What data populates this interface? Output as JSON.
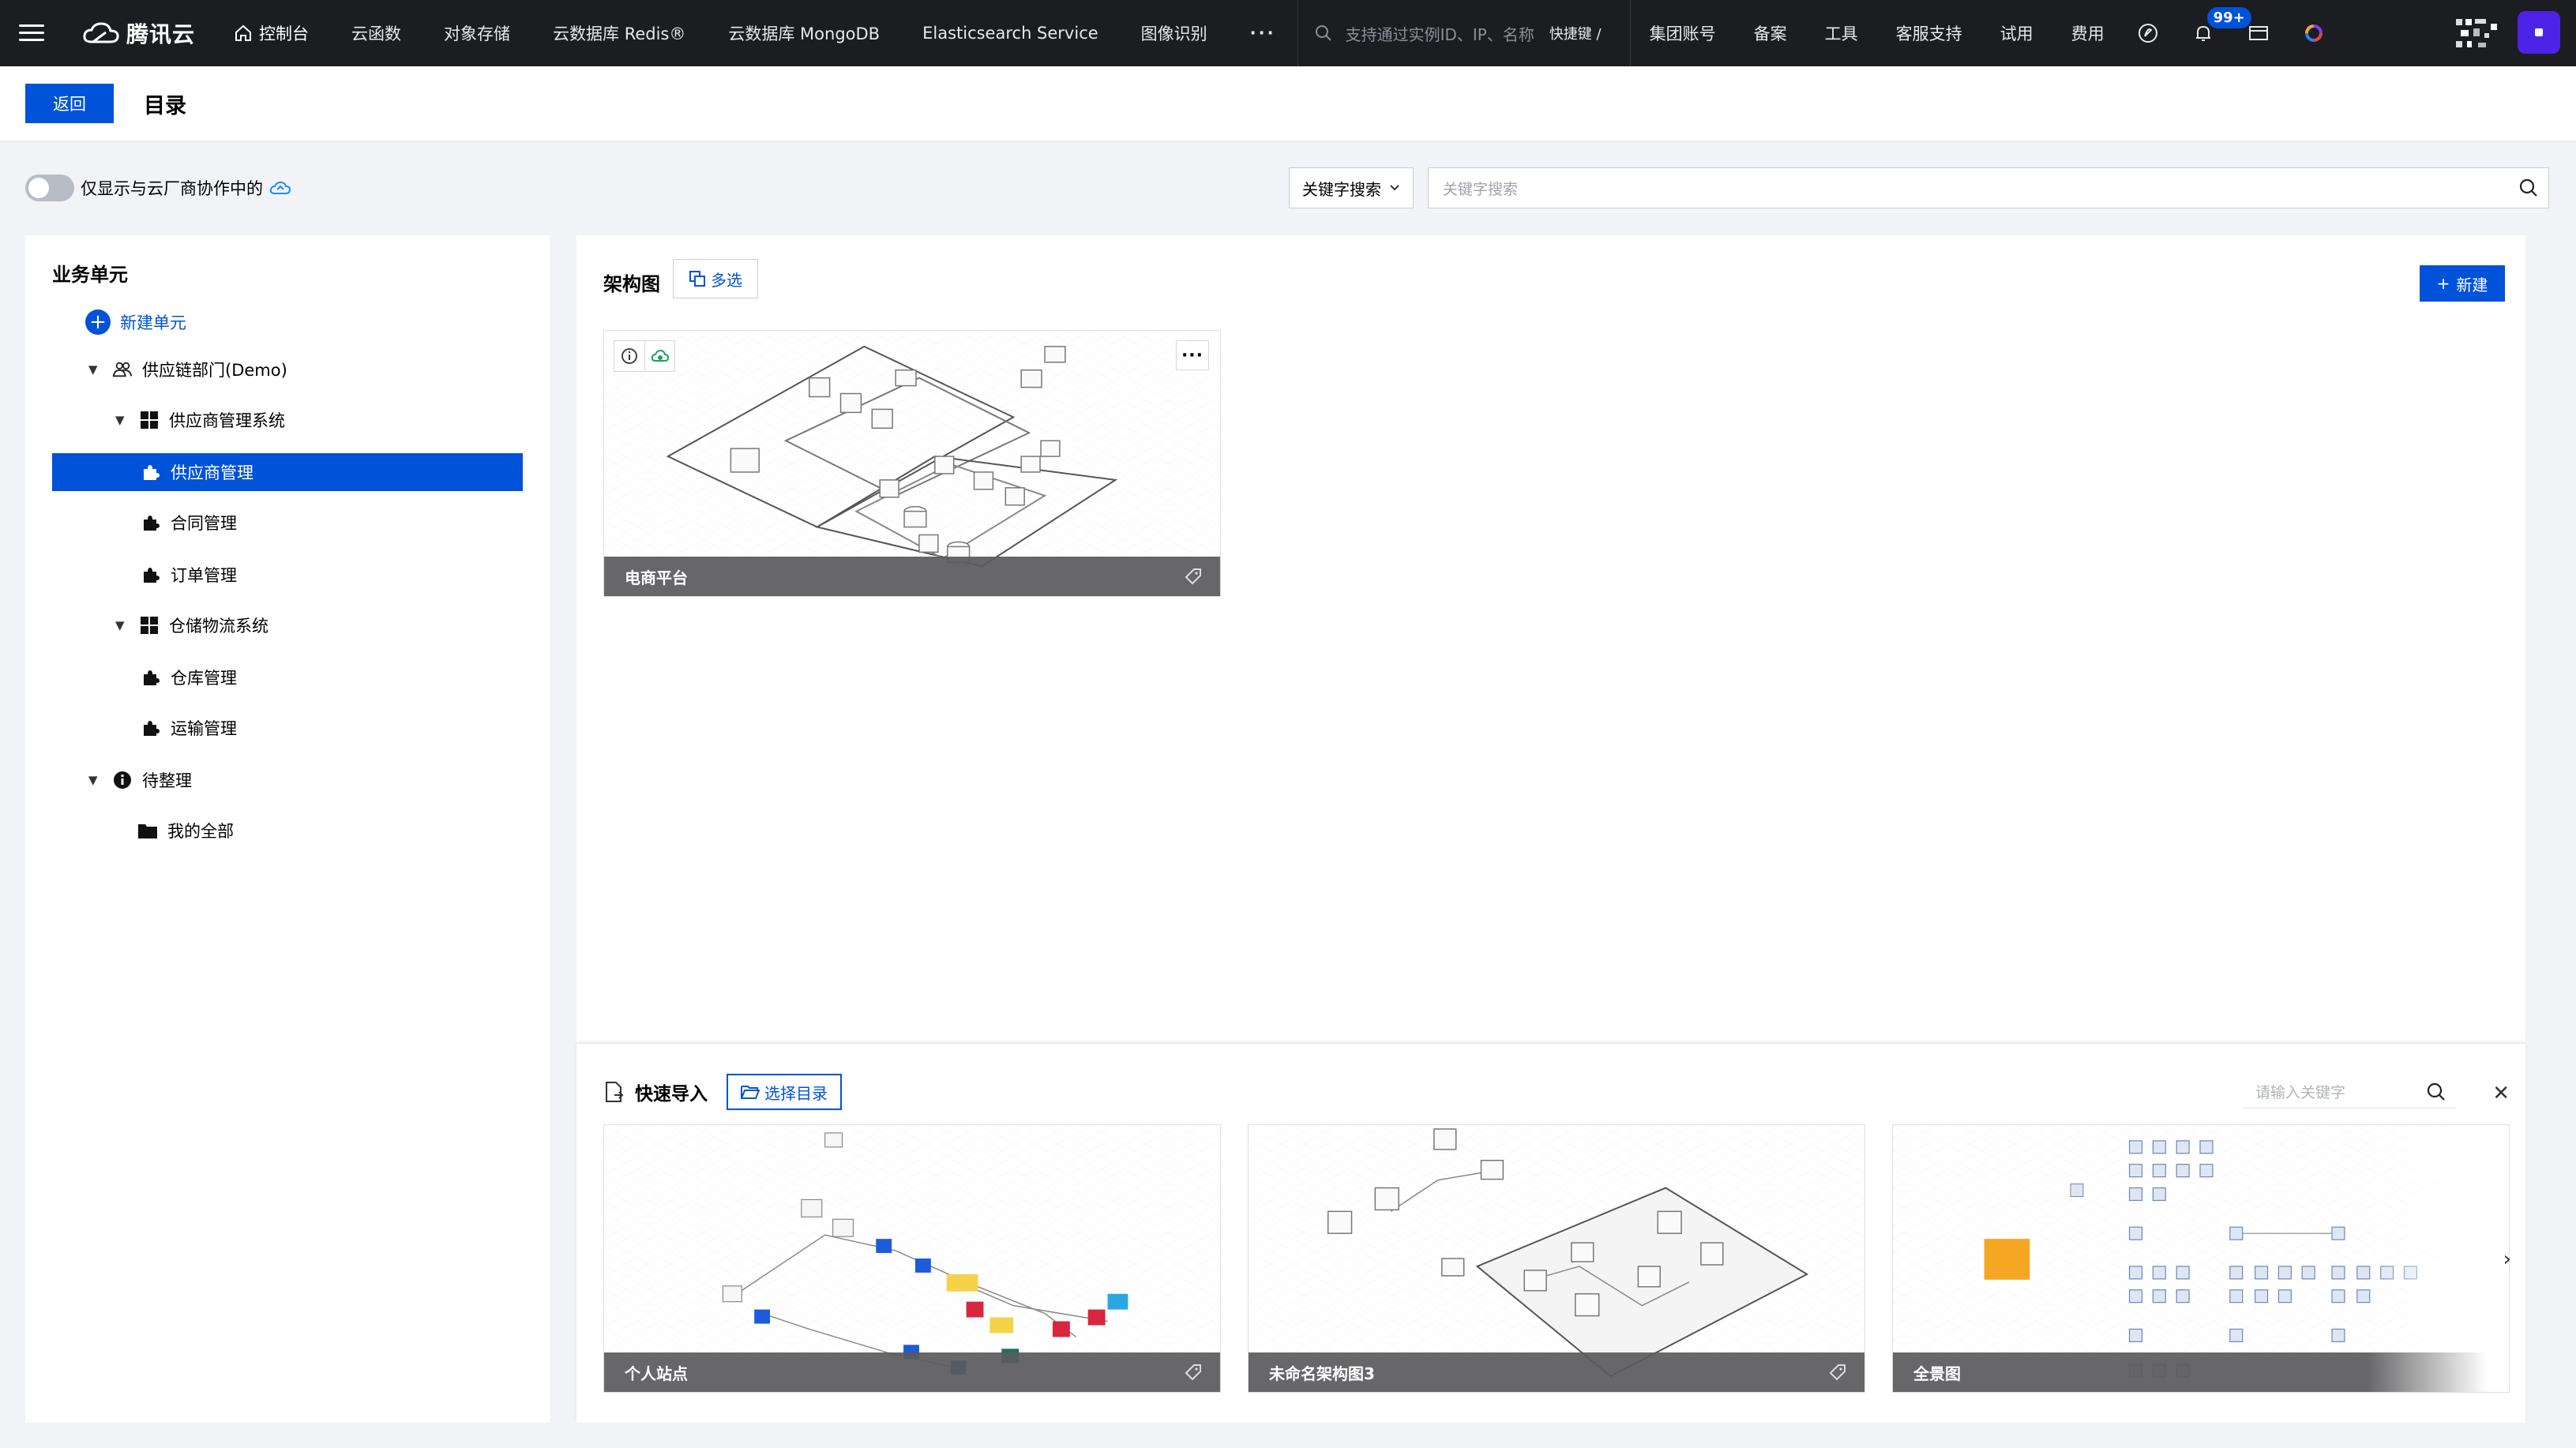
{
  "topbar": {
    "brand": "腾讯云",
    "nav": [
      "控制台",
      "云函数",
      "对象存储",
      "云数据库 Redis®",
      "云数据库 MongoDB",
      "Elasticsearch Service",
      "图像识别"
    ],
    "more": "···",
    "search_placeholder": "支持通过实例ID、IP、名称",
    "shortcut": "快捷键 /",
    "right_links": [
      "集团账号",
      "备案",
      "工具",
      "客服支持",
      "试用",
      "费用"
    ],
    "notification_badge": "99+"
  },
  "header": {
    "back_label": "返回",
    "title": "目录"
  },
  "filter": {
    "toggle_label": "仅显示与云厂商协作中的",
    "select_value": "关键字搜索",
    "input_placeholder": "关键字搜索"
  },
  "sidebar": {
    "title": "业务单元",
    "new_unit": "新建单元",
    "tree": [
      {
        "label": "供应链部门(Demo)"
      },
      {
        "label": "供应商管理系统"
      },
      {
        "label": "供应商管理"
      },
      {
        "label": "合同管理"
      },
      {
        "label": "订单管理"
      },
      {
        "label": "仓储物流系统"
      },
      {
        "label": "仓库管理"
      },
      {
        "label": "运输管理"
      },
      {
        "label": "待整理"
      },
      {
        "label": "我的全部"
      }
    ]
  },
  "main": {
    "title": "架构图",
    "multi_select": "多选",
    "new_button": "新建",
    "cards": [
      {
        "name": "电商平台"
      }
    ]
  },
  "quick_import": {
    "title": "快速导入",
    "select_dir": "选择目录",
    "search_placeholder": "请输入关键字",
    "cards": [
      {
        "name": "个人站点"
      },
      {
        "name": "未命名架构图3"
      },
      {
        "name": "全景图"
      }
    ]
  },
  "colors": {
    "accent": "#0052d9",
    "topbar": "#1b1d21",
    "page_bg": "#f2f3f6"
  }
}
